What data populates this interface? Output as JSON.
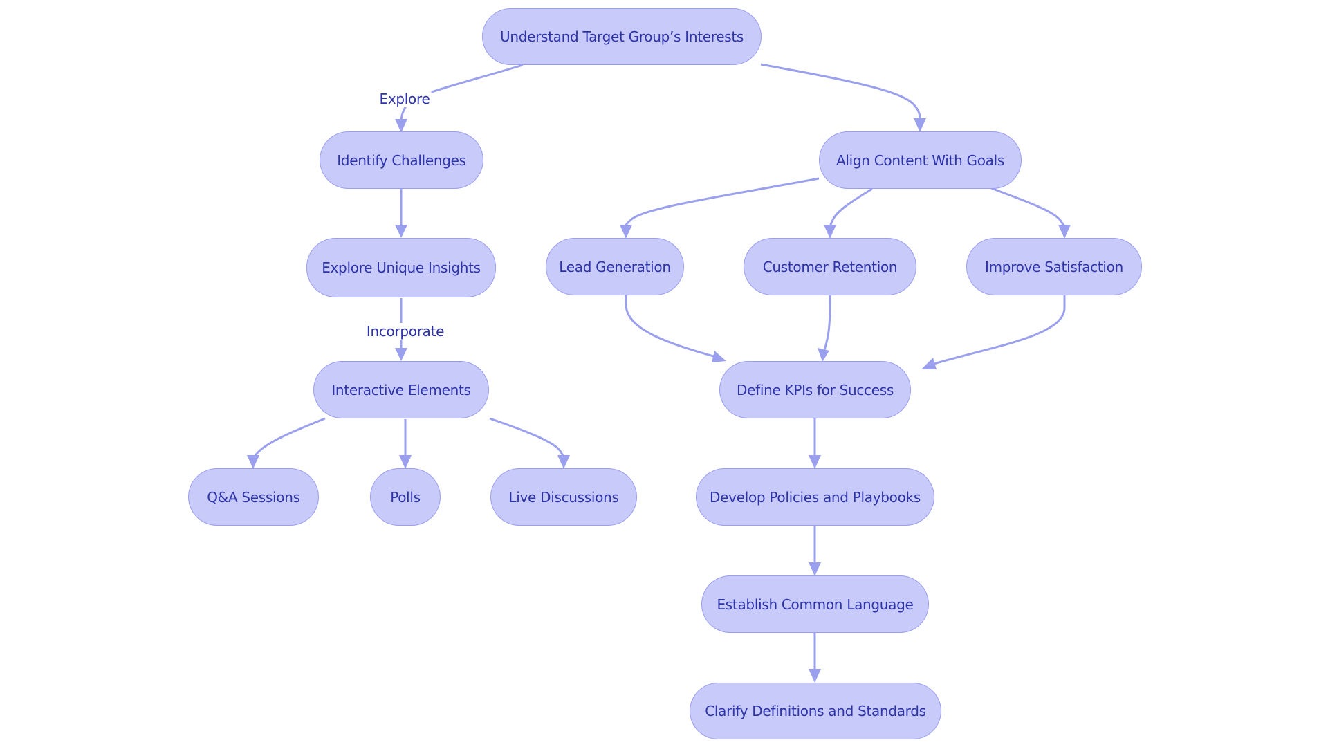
{
  "diagram": {
    "type": "flowchart",
    "colors": {
      "node_fill": "#c8caf9",
      "node_stroke": "#9a9ef0",
      "text": "#2d33a8",
      "edge": "#9ba0ee",
      "background": "#ffffff"
    },
    "nodes": {
      "understand": "Understand Target Group’s Interests",
      "identify": "Identify Challenges",
      "align": "Align Content With Goals",
      "explore_insights": "Explore Unique Insights",
      "lead": "Lead Generation",
      "retention": "Customer Retention",
      "satisfaction": "Improve Satisfaction",
      "interactive": "Interactive Elements",
      "kpis": "Define KPIs for Success",
      "qa": "Q&A Sessions",
      "polls": "Polls",
      "live": "Live Discussions",
      "policies": "Develop Policies and Playbooks",
      "language": "Establish Common Language",
      "clarify": "Clarify Definitions and Standards"
    },
    "edge_labels": {
      "explore": "Explore",
      "incorporate": "Incorporate"
    },
    "edges": [
      {
        "from": "understand",
        "to": "identify",
        "label": "Explore"
      },
      {
        "from": "understand",
        "to": "align",
        "label": ""
      },
      {
        "from": "identify",
        "to": "explore_insights",
        "label": ""
      },
      {
        "from": "explore_insights",
        "to": "interactive",
        "label": "Incorporate"
      },
      {
        "from": "interactive",
        "to": "qa",
        "label": ""
      },
      {
        "from": "interactive",
        "to": "polls",
        "label": ""
      },
      {
        "from": "interactive",
        "to": "live",
        "label": ""
      },
      {
        "from": "align",
        "to": "lead",
        "label": ""
      },
      {
        "from": "align",
        "to": "retention",
        "label": ""
      },
      {
        "from": "align",
        "to": "satisfaction",
        "label": ""
      },
      {
        "from": "lead",
        "to": "kpis",
        "label": ""
      },
      {
        "from": "retention",
        "to": "kpis",
        "label": ""
      },
      {
        "from": "satisfaction",
        "to": "kpis",
        "label": ""
      },
      {
        "from": "kpis",
        "to": "policies",
        "label": ""
      },
      {
        "from": "policies",
        "to": "language",
        "label": ""
      },
      {
        "from": "language",
        "to": "clarify",
        "label": ""
      }
    ]
  }
}
